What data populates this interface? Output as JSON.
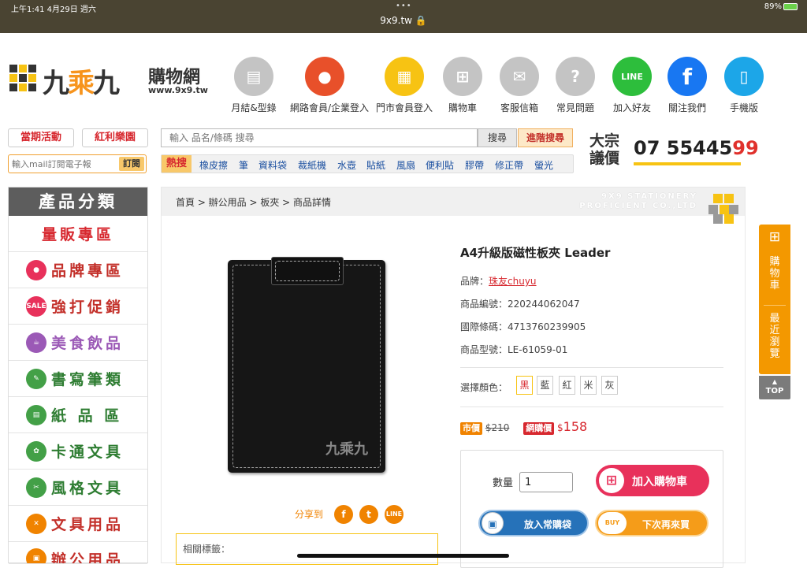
{
  "statusbar": {
    "time": "上午1:41   4月29日 週六",
    "url": "9x9.tw 🔒",
    "battery": "89%",
    "dots": "•••"
  },
  "logo": {
    "first": "九",
    "middle": "乘",
    "last": "九",
    "shop": "購物網",
    "domain": "www.9x9.tw"
  },
  "topnav": [
    {
      "label": "月結&型錄",
      "icon": "catalog-icon",
      "color": "#c4c4c4",
      "glyph": "▤"
    },
    {
      "label": "網路會員/企業登入",
      "icon": "member-icon",
      "color": "#e8502a",
      "glyph": "👥"
    },
    {
      "label": "門市會員登入",
      "icon": "store-member-icon",
      "color": "#f7c313",
      "glyph": "▦"
    },
    {
      "label": "購物車",
      "icon": "cart-icon",
      "color": "#c4c4c4",
      "glyph": "🛒"
    },
    {
      "label": "客服信箱",
      "icon": "mail-icon",
      "color": "#c4c4c4",
      "glyph": "✉"
    },
    {
      "label": "常見問題",
      "icon": "faq-icon",
      "color": "#c4c4c4",
      "glyph": "?"
    },
    {
      "label": "加入好友",
      "icon": "line-icon",
      "color": "#2dbe3c",
      "glyph": "LINE"
    },
    {
      "label": "關注我們",
      "icon": "facebook-icon",
      "color": "#1877f2",
      "glyph": "f"
    },
    {
      "label": "手機版",
      "icon": "mobile-icon",
      "color": "#1ca6e8",
      "glyph": "▯"
    }
  ],
  "promos": {
    "event": "當期活動",
    "bonus": "紅利樂園"
  },
  "mail": {
    "placeholder": "輸入mail訂閱電子報",
    "submit": "訂閱"
  },
  "search": {
    "placeholder": "輸入 品名/條碼 搜尋",
    "button": "搜尋",
    "advanced": "進階搜尋"
  },
  "hot": {
    "label": "熱搜",
    "keywords": [
      "橡皮擦",
      "筆",
      "資料袋",
      "裁紙機",
      "水壺",
      "貼紙",
      "風扇",
      "便利貼",
      "膠帶",
      "修正帶",
      "螢光"
    ]
  },
  "bulk": {
    "label1": "大宗",
    "label2": "議價",
    "phone_a": "07 55445",
    "phone_b": "99"
  },
  "categories": {
    "title": "產品分類",
    "items": [
      {
        "label": "量販專區",
        "color": "#d7282f",
        "icon": "",
        "icolor": ""
      },
      {
        "label": "品牌專區",
        "color": "#c3302a",
        "icon": "brand-icon",
        "icolor": "#e8315b"
      },
      {
        "label": "強打促銷",
        "color": "#c3302a",
        "icon": "sale-icon",
        "icolor": "#e8315b"
      },
      {
        "label": "美食飲品",
        "color": "#9b59b6",
        "icon": "cup-icon",
        "icolor": "#9b59b6"
      },
      {
        "label": "書寫筆類",
        "color": "#2e7d32",
        "icon": "pen-icon",
        "icolor": "#43a047"
      },
      {
        "label": "紙 品 區",
        "color": "#2e7d32",
        "icon": "paper-icon",
        "icolor": "#43a047"
      },
      {
        "label": "卡通文具",
        "color": "#2e7d32",
        "icon": "paw-icon",
        "icolor": "#43a047"
      },
      {
        "label": "風格文具",
        "color": "#2e7d32",
        "icon": "style-icon",
        "icolor": "#43a047"
      },
      {
        "label": "文具用品",
        "color": "#c3302a",
        "icon": "tools-icon",
        "icolor": "#f08300"
      },
      {
        "label": "辦公用品",
        "color": "#c3302a",
        "icon": "office-icon",
        "icolor": "#f08300"
      }
    ]
  },
  "breadcrumb": "首頁 > 辦公用品 > 板夾 > 商品詳情",
  "watermark": {
    "line1": "9X9 STATIONERY",
    "line2": "PROFICIENT CO.,LTD"
  },
  "product": {
    "title": "A4升級版磁性板夾 Leader",
    "brand_label": "品牌：",
    "brand": "珠友chuyu",
    "code": "商品編號：220244062047",
    "barcode": "國際條碼：4713760239905",
    "model": "商品型號：LE-61059-01",
    "color_label": "選擇顏色：",
    "colors": [
      "黑",
      "藍",
      "紅",
      "米",
      "灰"
    ],
    "market_tag": "市價",
    "market_price": "$210",
    "web_tag": "網購價",
    "web_currency": "$",
    "web_price": "158",
    "image_mark": "九乘九",
    "qty_label": "數量",
    "qty": "1",
    "add_cart": "加入購物車",
    "fav": "放入常購袋",
    "next": "下次再來買",
    "next_icon": "BUY"
  },
  "share": {
    "label": "分享到"
  },
  "tags": {
    "label": "相關標籤："
  },
  "sidetab": {
    "cart": "購物車",
    "recent": "最近瀏覽",
    "top": "TOP"
  }
}
